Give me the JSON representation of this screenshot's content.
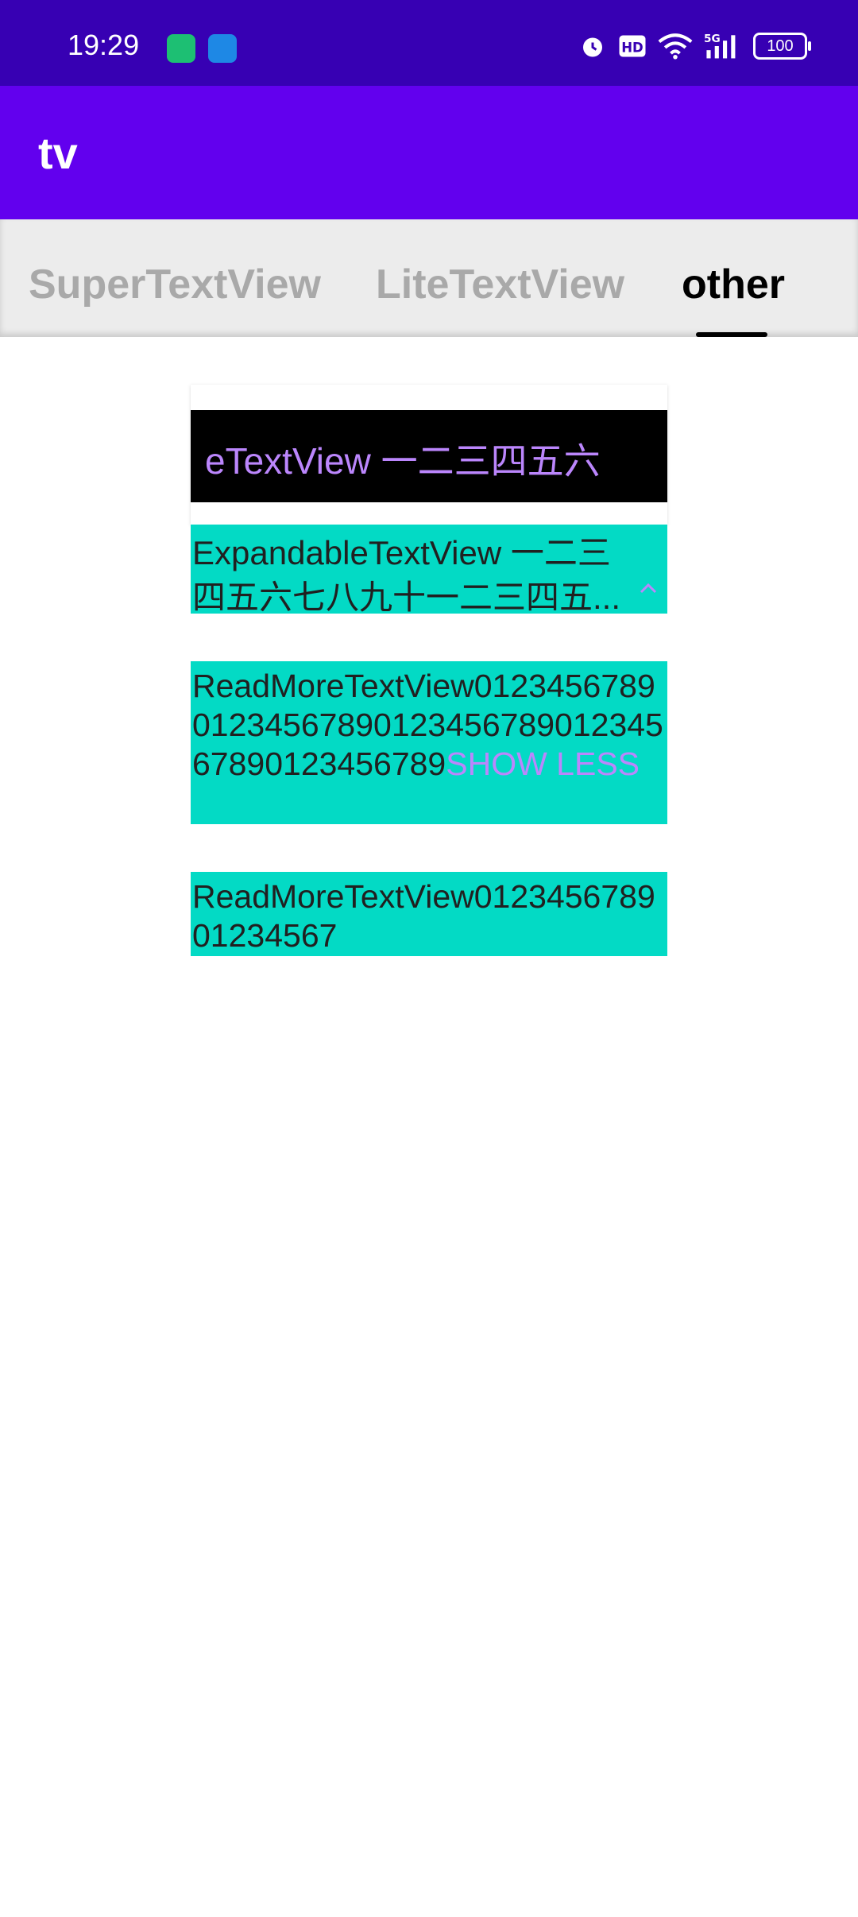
{
  "status_bar": {
    "time": "19:29",
    "notification_icons": [
      "battery-saver-app-icon",
      "navigation-app-icon"
    ],
    "right_icons": [
      "alarm-icon",
      "hd-icon",
      "wifi-icon",
      "5g-signal-icon"
    ],
    "network_label": "5G",
    "battery_level": "100"
  },
  "app_bar": {
    "title": "tv"
  },
  "tabs": [
    {
      "label": "SuperTextView",
      "selected": false
    },
    {
      "label": "LiteTextView",
      "selected": false
    },
    {
      "label": "other",
      "selected": true
    }
  ],
  "content": {
    "marquee_text": "eTextView  一二三四五六",
    "expandable": {
      "line1": "ExpandableTextView 一二三",
      "line2": "四五六七八九十一二三四五..."
    },
    "readmore_expanded": {
      "text": "ReadMoreTextView01234567890123456789012345678901234567890123456789",
      "toggle": "SHOW LESS"
    },
    "readmore_collapsed": {
      "text": "ReadMoreTextView012345678901234567"
    }
  },
  "colors": {
    "status_bar": "#3700B3",
    "app_bar": "#6200EE",
    "teal": "#03DAC5",
    "accent_text": "#BB86FC"
  }
}
